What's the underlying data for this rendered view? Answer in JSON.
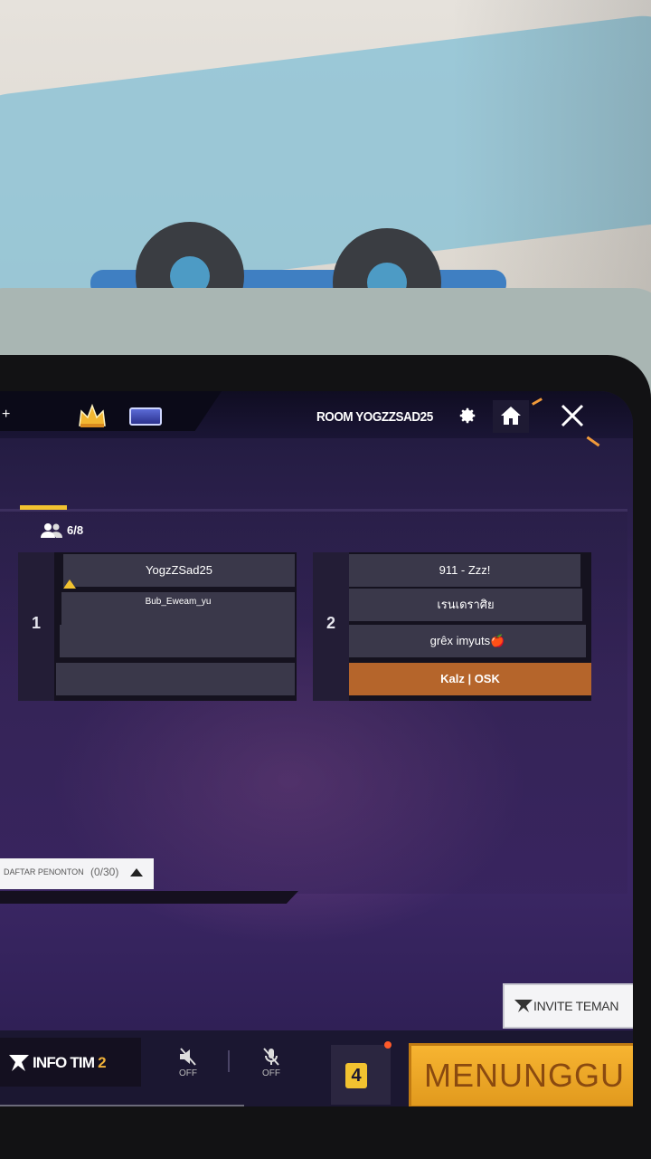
{
  "header": {
    "room_title": "ROOM YOGZZSAD25"
  },
  "lobby": {
    "player_count": "6/8",
    "teams": [
      {
        "number": "1",
        "slots": [
          "YogzZSad25",
          "Bub_Eweam_yu",
          "",
          ""
        ]
      },
      {
        "number": "2",
        "slots": [
          "911 - Zzz!",
          "เรนเดราศิย",
          "grêx imyuts🍎",
          "Kalz | OSK"
        ]
      }
    ],
    "spectators": {
      "label": "DAFTAR PENONTON",
      "count": "(0/30)"
    }
  },
  "actions": {
    "invite_label": "INVITE TEMAN",
    "info_label_main": "INFO TIM",
    "info_label_num": "2",
    "mute_speaker_state": "OFF",
    "mute_mic_state": "OFF",
    "dice_value": "4",
    "ready_label": "MENUNGGU"
  },
  "colors": {
    "accent_orange": "#f09a3a",
    "ready_button": "#f7b431",
    "highlight_slot": "#b5652b",
    "leader_marker": "#f2c230"
  }
}
